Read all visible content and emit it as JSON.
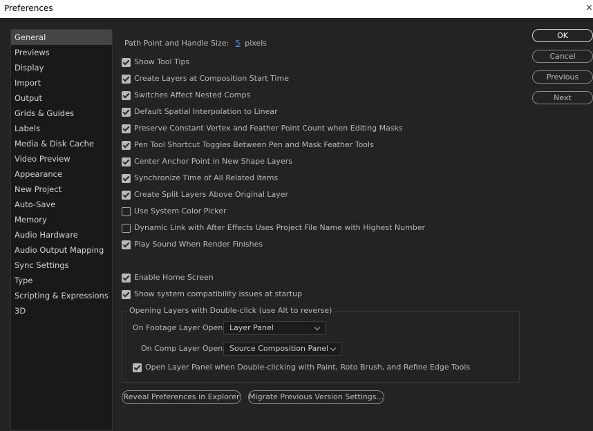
{
  "window": {
    "title": "Preferences",
    "close_glyph": "×"
  },
  "sidebar": {
    "items": [
      {
        "label": "General",
        "selected": true
      },
      {
        "label": "Previews"
      },
      {
        "label": "Display"
      },
      {
        "label": "Import"
      },
      {
        "label": "Output"
      },
      {
        "label": "Grids & Guides"
      },
      {
        "label": "Labels"
      },
      {
        "label": "Media & Disk Cache"
      },
      {
        "label": "Video Preview"
      },
      {
        "label": "Appearance"
      },
      {
        "label": "New Project"
      },
      {
        "label": "Auto-Save"
      },
      {
        "label": "Memory"
      },
      {
        "label": "Audio Hardware"
      },
      {
        "label": "Audio Output Mapping"
      },
      {
        "label": "Sync Settings"
      },
      {
        "label": "Type"
      },
      {
        "label": "Scripting & Expressions"
      },
      {
        "label": "3D"
      }
    ]
  },
  "general": {
    "path_point_label": "Path Point and Handle Size:",
    "path_point_value": "5",
    "path_point_unit": "pixels",
    "options": [
      {
        "label": "Show Tool Tips",
        "checked": true
      },
      {
        "label": "Create Layers at Composition Start Time",
        "checked": true
      },
      {
        "label": "Switches Affect Nested Comps",
        "checked": true
      },
      {
        "label": "Default Spatial Interpolation to Linear",
        "checked": true
      },
      {
        "label": "Preserve Constant Vertex and Feather Point Count when Editing Masks",
        "checked": true
      },
      {
        "label": "Pen Tool Shortcut Toggles Between Pen and Mask Feather Tools",
        "checked": true
      },
      {
        "label": "Center Anchor Point in New Shape Layers",
        "checked": true
      },
      {
        "label": "Synchronize Time of All Related Items",
        "checked": true
      },
      {
        "label": "Create Split Layers Above Original Layer",
        "checked": true
      },
      {
        "label": "Use System Color Picker",
        "checked": false
      },
      {
        "label": "Dynamic Link with After Effects Uses Project File Name with Highest Number",
        "checked": false
      },
      {
        "label": "Play Sound When Render Finishes",
        "checked": true
      }
    ],
    "options2": [
      {
        "label": "Enable Home Screen",
        "checked": true
      },
      {
        "label": "Show system compatibility issues at startup",
        "checked": true
      }
    ],
    "double_click_group": {
      "title": "Opening Layers with Double-click (use Alt to reverse)",
      "footage_label": "On Footage Layer Opens:",
      "footage_value": "Layer Panel",
      "comp_label": "On Comp Layer Opens:",
      "comp_value": "Source Composition Panel",
      "open_layer_panel_label": "Open Layer Panel when Double-clicking with Paint, Roto Brush, and Refine Edge Tools",
      "open_layer_panel_checked": true
    },
    "reveal_button": "Reveal Preferences in Explorer",
    "migrate_button": "Migrate Previous Version Settings..."
  },
  "buttons": {
    "ok": "OK",
    "cancel": "Cancel",
    "previous": "Previous",
    "next": "Next"
  }
}
